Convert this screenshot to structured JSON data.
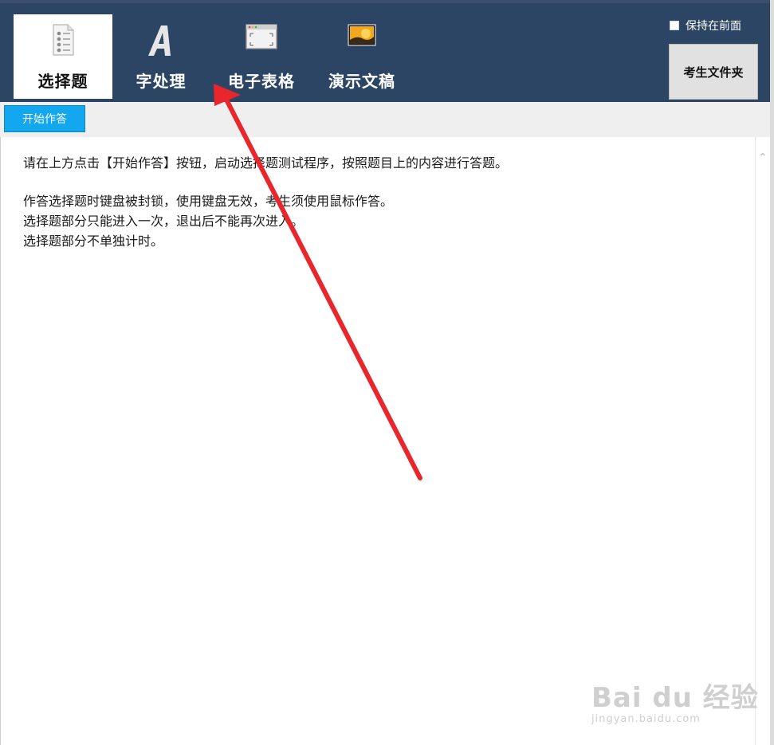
{
  "tabs": [
    {
      "label": "选择题",
      "icon": "document-list-icon",
      "active": true
    },
    {
      "label": "字处理",
      "icon": "letter-a-icon",
      "active": false
    },
    {
      "label": "电子表格",
      "icon": "window-icon",
      "active": false
    },
    {
      "label": "演示文稿",
      "icon": "slide-image-icon",
      "active": false
    }
  ],
  "header": {
    "keep_front_label": "保持在前面",
    "folder_button_label": "考生文件夹"
  },
  "toolbar": {
    "start_button_label": "开始作答"
  },
  "content": {
    "lines": [
      "请在上方点击【开始作答】按钮，启动选择题测试程序，按照题目上的内容进行答题。",
      "作答选择题时键盘被封锁，使用键盘无效，考生须使用鼠标作答。",
      "选择题部分只能进入一次，退出后不能再次进入。",
      "选择题部分不单独计时。"
    ]
  },
  "watermark": {
    "main": "Bai du 经验",
    "sub": "jingyan.baidu.com"
  },
  "colors": {
    "header_bg": "#2d4565",
    "start_button_bg": "#12a7ee",
    "arrow_red": "#e8262b"
  }
}
